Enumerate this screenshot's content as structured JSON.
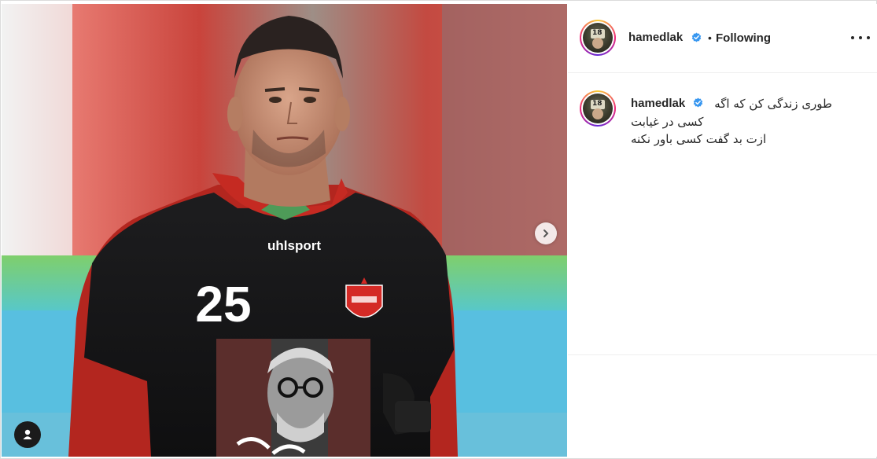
{
  "post": {
    "username": "hamedlak",
    "verified": true,
    "follow_status": "Following",
    "separator": "•"
  },
  "caption": {
    "username": "hamedlak",
    "lines": [
      "طوری زندگی کن که اگه",
      "کسی در غیابت",
      "ازت بد گفت کسی باور نکنه"
    ]
  },
  "media": {
    "jersey_brand": "uhlsport",
    "jersey_number": "25",
    "carousel_has_next": true
  },
  "icons": {
    "verified": "verified-badge-icon",
    "more": "more-options-icon",
    "next": "chevron-right-icon",
    "tag": "user-tag-icon"
  },
  "colors": {
    "verified_blue": "#3897f0",
    "jersey_black": "#151515",
    "club_red": "#d42a26"
  }
}
